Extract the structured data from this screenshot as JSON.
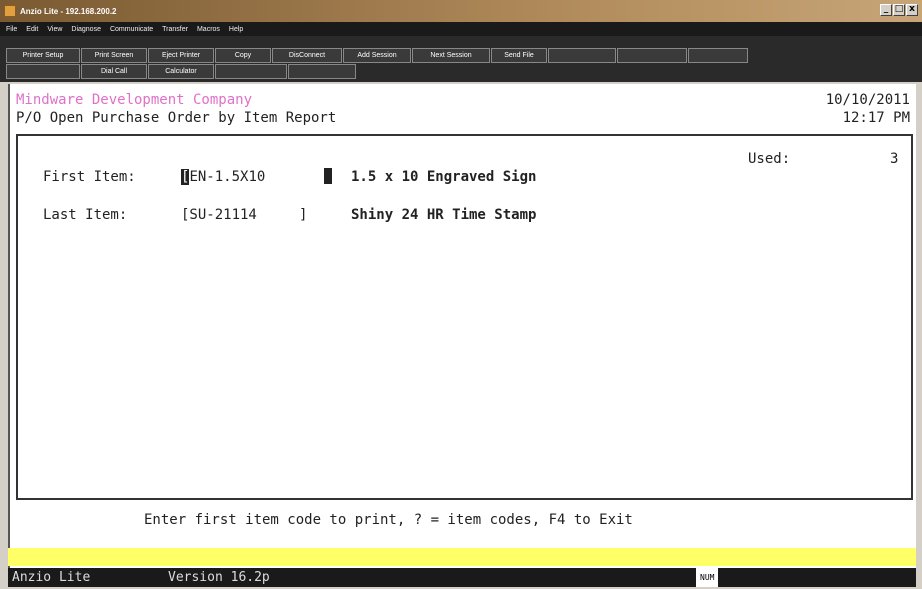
{
  "window": {
    "title": "Anzio Lite - 192.168.200.2",
    "minimize": "_",
    "maximize": "□",
    "close": "x"
  },
  "menubar": {
    "items": [
      "File",
      "Edit",
      "View",
      "Diagnose",
      "Communicate",
      "Transfer",
      "Macros",
      "Help"
    ]
  },
  "toolbar": {
    "row1": [
      {
        "label": "Printer Setup",
        "enabled": true
      },
      {
        "label": "Print Screen",
        "enabled": true
      },
      {
        "label": "Eject Printer",
        "enabled": true
      },
      {
        "label": "Copy",
        "enabled": true
      },
      {
        "label": "DisConnect",
        "enabled": true
      },
      {
        "label": "Add Session",
        "enabled": true
      },
      {
        "label": "Next Session",
        "enabled": true
      },
      {
        "label": "Send File",
        "enabled": true
      },
      {
        "label": "",
        "enabled": false
      },
      {
        "label": "",
        "enabled": false
      },
      {
        "label": "",
        "enabled": false
      }
    ],
    "row2": [
      {
        "label": "",
        "enabled": false
      },
      {
        "label": "Dial Call",
        "enabled": true
      },
      {
        "label": "Calculator",
        "enabled": true
      },
      {
        "label": "",
        "enabled": false
      },
      {
        "label": "",
        "enabled": false
      }
    ]
  },
  "terminal": {
    "company": "Mindware Development Company",
    "report_title": "P/O Open Purchase Order by Item Report",
    "date": "10/10/2011",
    "time": "12:17 PM",
    "used_label": "Used:",
    "used_value": "3",
    "first_item_label": "First Item:",
    "first_item_cursor": "[",
    "first_item_value": "EN-1.5X10",
    "first_item_desc": "1.5 x 10 Engraved Sign",
    "last_item_label": "Last Item:",
    "last_item_value": "[SU-21114     ]",
    "last_item_desc": "Shiny 24 HR Time Stamp",
    "prompt": "Enter first item code to print, ? = item codes, F4 to Exit"
  },
  "statusbar": {
    "app": "Anzio Lite",
    "version": "Version 16.2p",
    "num": "NUM"
  }
}
